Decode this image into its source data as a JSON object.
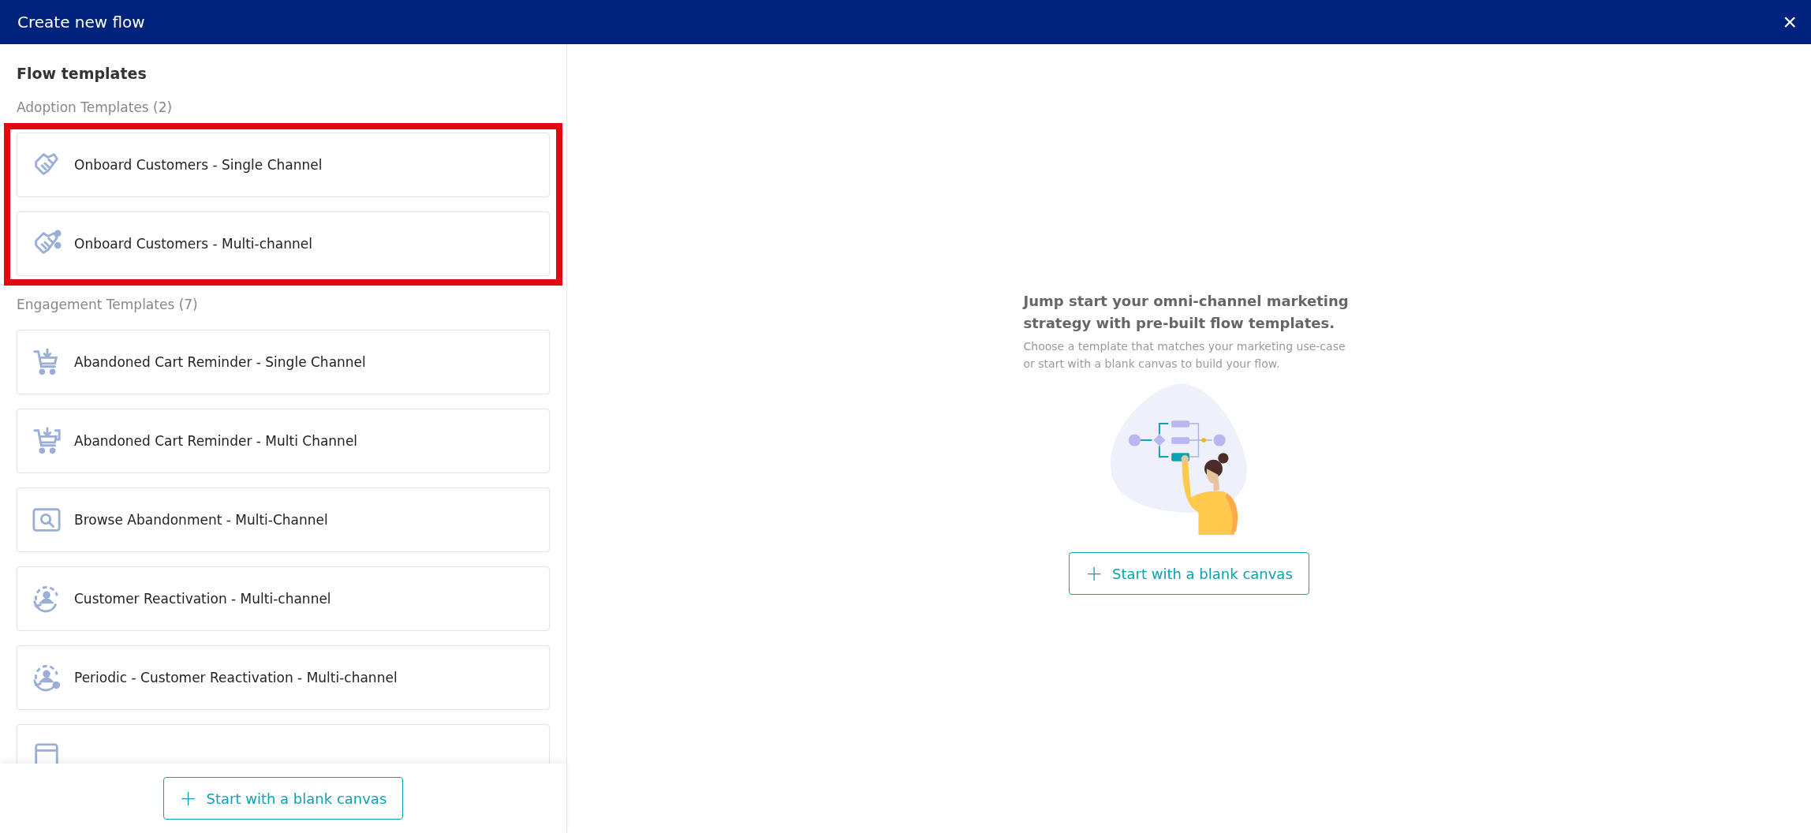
{
  "window": {
    "title": "Create new flow",
    "close_label": "×"
  },
  "sidebar": {
    "title": "Flow templates",
    "groups": [
      {
        "title": "Adoption Templates (2)",
        "highlighted": true,
        "items": [
          {
            "kind": "handshake",
            "label": "Onboard Customers - Single Channel"
          },
          {
            "kind": "handshake-multi",
            "label": "Onboard Customers - Multi-channel"
          }
        ]
      },
      {
        "title": "Engagement Templates (7)",
        "highlighted": false,
        "items": [
          {
            "kind": "cart",
            "label": "Abandoned Cart Reminder - Single Channel"
          },
          {
            "kind": "cart-multi",
            "label": "Abandoned Cart Reminder - Multi Channel"
          },
          {
            "kind": "browse",
            "label": "Browse Abandonment - Multi-Channel"
          },
          {
            "kind": "reactivation",
            "label": "Customer Reactivation - Multi-channel"
          },
          {
            "kind": "reactivation-periodic",
            "label": "Periodic - Customer Reactivation - Multi-channel"
          },
          {
            "kind": "document"
          }
        ]
      }
    ],
    "footer_button": {
      "icon": "+",
      "label": "Start with a blank canvas"
    }
  },
  "main": {
    "heading": "Jump start your omni-channel marketing strategy with pre-built flow templates.",
    "description": "Choose a template that matches your marketing use-case or start with a blank canvas to build your flow.",
    "button": {
      "icon": "+",
      "label": "Start with a blank canvas"
    }
  }
}
